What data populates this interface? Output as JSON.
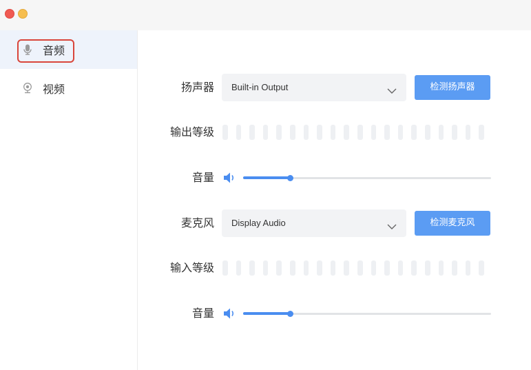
{
  "window": {
    "controls": [
      "close",
      "minimize"
    ]
  },
  "sidebar": {
    "items": [
      {
        "label": "音频",
        "icon": "microphone-icon",
        "active": true
      },
      {
        "label": "视频",
        "icon": "camera-icon",
        "active": false
      }
    ]
  },
  "speaker": {
    "label": "扬声器",
    "selected": "Built-in Output",
    "test_button": "检测扬声器",
    "level_label": "输出等级",
    "volume_label": "音量",
    "volume": 0.19
  },
  "microphone": {
    "label": "麦克风",
    "selected": "Display Audio",
    "test_button": "检测麦克风",
    "level_label": "输入等级",
    "volume_label": "音量",
    "volume": 0.19
  },
  "colors": {
    "accent": "#4a8df0",
    "button": "#5b9cf3",
    "highlight": "#d9453a"
  }
}
